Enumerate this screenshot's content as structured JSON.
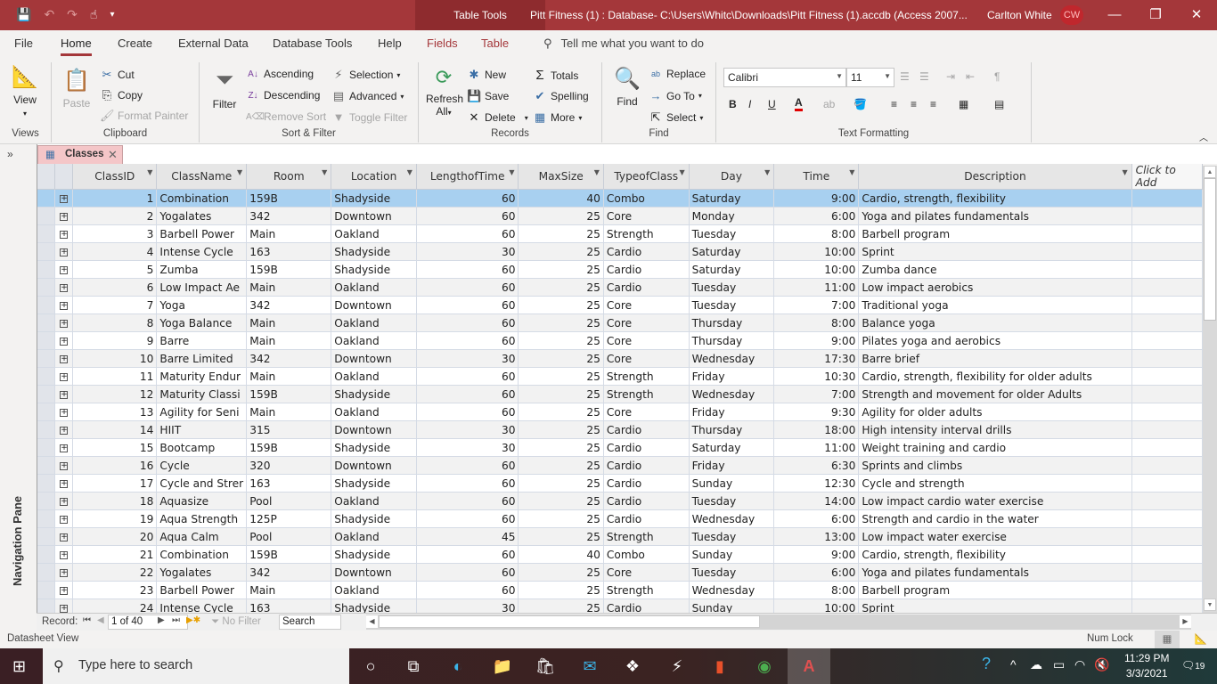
{
  "window": {
    "context_tab_group": "Table Tools",
    "title": "Pitt Fitness (1) : Database- C:\\Users\\Whitc\\Downloads\\Pitt Fitness (1).accdb (Access 2007...",
    "user_name": "Carlton White",
    "user_initials": "CW",
    "minimize": "—",
    "restore": "❐",
    "close": "✕"
  },
  "menu": {
    "tabs": [
      "File",
      "Home",
      "Create",
      "External Data",
      "Database Tools",
      "Help",
      "Fields",
      "Table"
    ],
    "active": "Home",
    "tell_me": "Tell me what you want to do"
  },
  "ribbon": {
    "views": {
      "label": "Views",
      "view": "View"
    },
    "clipboard": {
      "label": "Clipboard",
      "paste": "Paste",
      "cut": "Cut",
      "copy": "Copy",
      "format_painter": "Format Painter"
    },
    "sort_filter": {
      "label": "Sort & Filter",
      "filter": "Filter",
      "ascending": "Ascending",
      "descending": "Descending",
      "remove_sort": "Remove Sort",
      "selection": "Selection",
      "advanced": "Advanced",
      "toggle_filter": "Toggle Filter"
    },
    "records": {
      "label": "Records",
      "refresh": "Refresh",
      "refresh_all": "All",
      "new": "New",
      "save": "Save",
      "delete": "Delete",
      "totals": "Totals",
      "spelling": "Spelling",
      "more": "More"
    },
    "find": {
      "label": "Find",
      "find": "Find",
      "replace": "Replace",
      "go_to": "Go To",
      "select": "Select"
    },
    "text_formatting": {
      "label": "Text Formatting",
      "font": "Calibri",
      "size": "11",
      "bold": "B",
      "italic": "I",
      "underline": "U",
      "font_color": "#e00000"
    }
  },
  "nav_pane": {
    "label": "Navigation Pane",
    "toggle": "»"
  },
  "document_tab": {
    "label": "Classes"
  },
  "table": {
    "columns": [
      "ClassID",
      "ClassName",
      "Room",
      "Location",
      "LengthofTime",
      "MaxSize",
      "TypeofClass",
      "Day",
      "Time",
      "Description",
      "Click to Add"
    ],
    "selected_row": 0,
    "rows": [
      [
        "1",
        "Combination",
        "159B",
        "Shadyside",
        "60",
        "40",
        "Combo",
        "Saturday",
        "9:00",
        "Cardio, strength, flexibility"
      ],
      [
        "2",
        "Yogalates",
        "342",
        "Downtown",
        "60",
        "25",
        "Core",
        "Monday",
        "6:00",
        "Yoga and pilates fundamentals"
      ],
      [
        "3",
        "Barbell Power",
        "Main",
        "Oakland",
        "60",
        "25",
        "Strength",
        "Tuesday",
        "8:00",
        "Barbell program"
      ],
      [
        "4",
        "Intense Cycle",
        "163",
        "Shadyside",
        "30",
        "25",
        "Cardio",
        "Saturday",
        "10:00",
        "Sprint"
      ],
      [
        "5",
        "Zumba",
        "159B",
        "Shadyside",
        "60",
        "25",
        "Cardio",
        "Saturday",
        "10:00",
        "Zumba dance"
      ],
      [
        "6",
        "Low Impact Ae",
        "Main",
        "Oakland",
        "60",
        "25",
        "Cardio",
        "Tuesday",
        "11:00",
        "Low impact aerobics"
      ],
      [
        "7",
        "Yoga",
        "342",
        "Downtown",
        "60",
        "25",
        "Core",
        "Tuesday",
        "7:00",
        "Traditional yoga"
      ],
      [
        "8",
        "Yoga Balance",
        "Main",
        "Oakland",
        "60",
        "25",
        "Core",
        "Thursday",
        "8:00",
        "Balance yoga"
      ],
      [
        "9",
        "Barre",
        "Main",
        "Oakland",
        "60",
        "25",
        "Core",
        "Thursday",
        "9:00",
        "Pilates yoga and aerobics"
      ],
      [
        "10",
        "Barre Limited",
        "342",
        "Downtown",
        "30",
        "25",
        "Core",
        "Wednesday",
        "17:30",
        "Barre brief"
      ],
      [
        "11",
        "Maturity Endur",
        "Main",
        "Oakland",
        "60",
        "25",
        "Strength",
        "Friday",
        "10:30",
        "Cardio, strength, flexibility for older adults"
      ],
      [
        "12",
        "Maturity Classi",
        "159B",
        "Shadyside",
        "60",
        "25",
        "Strength",
        "Wednesday",
        "7:00",
        "Strength and movement for older Adults"
      ],
      [
        "13",
        "Agility for Seni",
        "Main",
        "Oakland",
        "60",
        "25",
        "Core",
        "Friday",
        "9:30",
        "Agility for older adults"
      ],
      [
        "14",
        "HIIT",
        "315",
        "Downtown",
        "30",
        "25",
        "Cardio",
        "Thursday",
        "18:00",
        "High intensity interval drills"
      ],
      [
        "15",
        "Bootcamp",
        "159B",
        "Shadyside",
        "30",
        "25",
        "Cardio",
        "Saturday",
        "11:00",
        "Weight training and cardio"
      ],
      [
        "16",
        "Cycle",
        "320",
        "Downtown",
        "60",
        "25",
        "Cardio",
        "Friday",
        "6:30",
        "Sprints and climbs"
      ],
      [
        "17",
        "Cycle and Strer",
        "163",
        "Shadyside",
        "60",
        "25",
        "Cardio",
        "Sunday",
        "12:30",
        "Cycle and strength"
      ],
      [
        "18",
        "Aquasize",
        "Pool",
        "Oakland",
        "60",
        "25",
        "Cardio",
        "Tuesday",
        "14:00",
        "Low impact cardio water exercise"
      ],
      [
        "19",
        "Aqua Strength",
        "125P",
        "Shadyside",
        "60",
        "25",
        "Cardio",
        "Wednesday",
        "6:00",
        "Strength and cardio in the water"
      ],
      [
        "20",
        "Aqua Calm",
        "Pool",
        "Oakland",
        "45",
        "25",
        "Strength",
        "Tuesday",
        "13:00",
        "Low impact water exercise"
      ],
      [
        "21",
        "Combination",
        "159B",
        "Shadyside",
        "60",
        "40",
        "Combo",
        "Sunday",
        "9:00",
        "Cardio, strength, flexibility"
      ],
      [
        "22",
        "Yogalates",
        "342",
        "Downtown",
        "60",
        "25",
        "Core",
        "Tuesday",
        "6:00",
        "Yoga and pilates fundamentals"
      ],
      [
        "23",
        "Barbell Power",
        "Main",
        "Oakland",
        "60",
        "25",
        "Strength",
        "Wednesday",
        "8:00",
        "Barbell program"
      ],
      [
        "24",
        "Intense Cycle",
        "163",
        "Shadyside",
        "30",
        "25",
        "Cardio",
        "Sunday",
        "10:00",
        "Sprint"
      ]
    ]
  },
  "record_nav": {
    "label": "Record:",
    "current": "1 of 40",
    "filter_status": "No Filter",
    "search": "Search"
  },
  "status_bar": {
    "view": "Datasheet View",
    "num_lock": "Num Lock"
  },
  "taskbar": {
    "search_placeholder": "Type here to search",
    "time": "11:29 PM",
    "date": "3/3/2021",
    "notifications": "19"
  }
}
